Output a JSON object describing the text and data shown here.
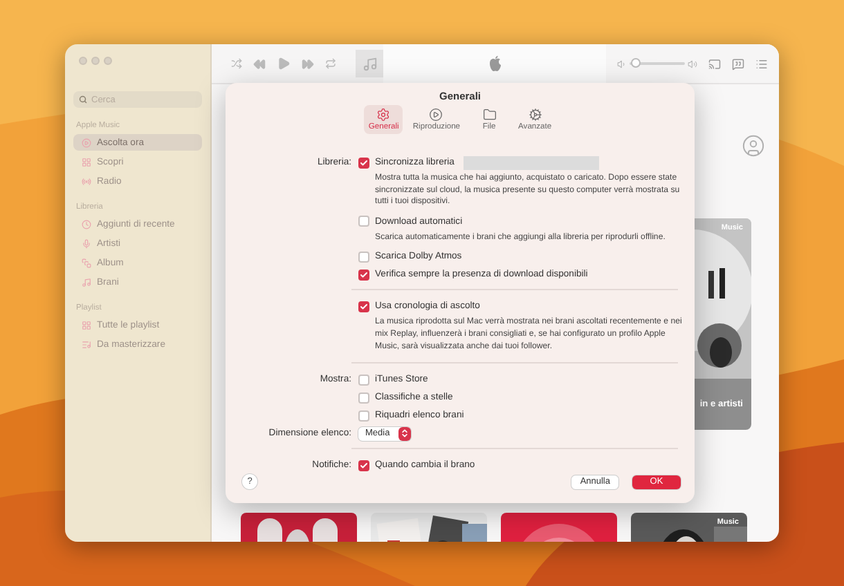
{
  "sidebar": {
    "search": {
      "placeholder": "Cerca"
    },
    "sections": [
      {
        "title": "Apple Music",
        "items": [
          {
            "label": "Ascolta ora",
            "selected": true
          },
          {
            "label": "Scopri",
            "selected": false
          },
          {
            "label": "Radio",
            "selected": false
          }
        ]
      },
      {
        "title": "Libreria",
        "items": [
          {
            "label": "Aggiunti di recente",
            "selected": false
          },
          {
            "label": "Artisti",
            "selected": false
          },
          {
            "label": "Album",
            "selected": false
          },
          {
            "label": "Brani",
            "selected": false
          }
        ]
      },
      {
        "title": "Playlist",
        "items": [
          {
            "label": "Tutte le playlist",
            "selected": false
          },
          {
            "label": "Da masterizzare",
            "selected": false
          }
        ]
      }
    ]
  },
  "player": {
    "volume": {
      "level": 0.1
    }
  },
  "content": {
    "featured_card": {
      "badge": "Music",
      "caption": "in e artisti"
    },
    "bottom_cards": [
      {
        "kind": "picture"
      },
      {
        "kind": "picture"
      },
      {
        "kind": "picture"
      },
      {
        "kind": "picture",
        "badge": "Music"
      }
    ]
  },
  "dialog": {
    "title": "Generali",
    "tabs": [
      {
        "label": "Generali",
        "selected": true
      },
      {
        "label": "Riproduzione",
        "selected": false
      },
      {
        "label": "File",
        "selected": false
      },
      {
        "label": "Avanzate",
        "selected": false
      }
    ],
    "sections": [
      [
        {
          "kind": "checkbox",
          "label": "Libreria:",
          "text": "Sincronizza libreria",
          "checked": true,
          "redacted": true
        },
        {
          "kind": "description",
          "text": "Mostra tutta la musica che hai aggiunto, acquistato o caricato. Dopo essere state sincronizzate sul cloud, la musica presente su questo computer verrà mostrata su tutti i tuoi dispositivi."
        },
        {
          "kind": "checkbox",
          "text": "Download automatici",
          "checked": false
        },
        {
          "kind": "description",
          "text": "Scarica automaticamente i brani che aggiungi alla libreria per riprodurli offline."
        },
        {
          "kind": "checkbox",
          "text": "Scarica Dolby Atmos",
          "checked": false
        },
        {
          "kind": "checkbox",
          "text": "Verifica sempre la presenza di download disponibili",
          "checked": true
        }
      ],
      [
        {
          "kind": "checkbox",
          "text": "Usa cronologia di ascolto",
          "checked": true
        },
        {
          "kind": "description",
          "text": "La musica riprodotta sul Mac verrà mostrata nei brani ascoltati recentemente e nei mix Replay, influenzerà i brani consigliati e, se hai configurato un profilo Apple Music, sarà visualizzata anche dai tuoi follower."
        }
      ],
      [
        {
          "kind": "checkbox",
          "label": "Mostra:",
          "text": "iTunes Store",
          "checked": false
        },
        {
          "kind": "checkbox",
          "text": "Classifiche a stelle",
          "checked": false
        },
        {
          "kind": "checkbox",
          "text": "Riquadri elenco brani",
          "checked": false
        },
        {
          "kind": "popup",
          "label": "Dimensione elenco:",
          "text": "Media"
        }
      ],
      [
        {
          "kind": "checkbox",
          "label": "Notifiche:",
          "text": "Quando cambia il brano",
          "checked": true
        }
      ]
    ],
    "help": "?",
    "buttons": [
      {
        "label": "Annulla",
        "kind": "cancel"
      },
      {
        "label": "OK",
        "kind": "default"
      }
    ]
  }
}
